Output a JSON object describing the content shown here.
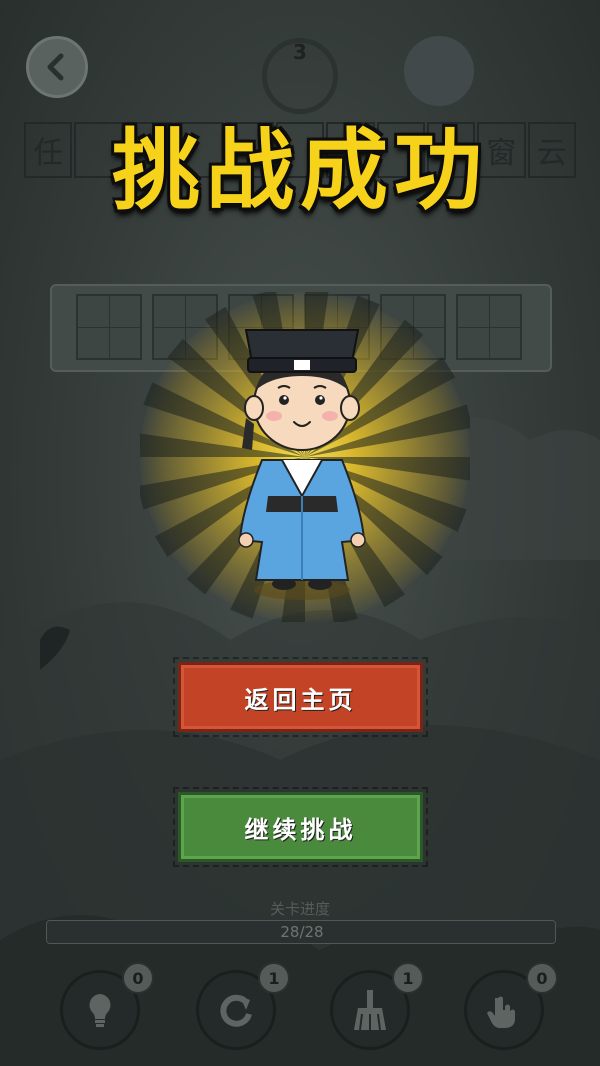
{
  "level": {
    "number": "3"
  },
  "clue_cells": [
    "任",
    "",
    "",
    "",
    "",
    "",
    "",
    "",
    "",
    "窗",
    "云"
  ],
  "title": "挑战成功",
  "buttons": {
    "home_label": "返回主页",
    "continue_label": "继续挑战"
  },
  "progress": {
    "label": "关卡进度",
    "text": "28/28",
    "current": 28,
    "total": 28
  },
  "tools": [
    {
      "name": "hint",
      "icon": "lightbulb-icon",
      "count": "0"
    },
    {
      "name": "refresh",
      "icon": "refresh-icon",
      "count": "1"
    },
    {
      "name": "clear",
      "icon": "broom-icon",
      "count": "1"
    },
    {
      "name": "pointer",
      "icon": "hand-pointer-icon",
      "count": "0"
    }
  ],
  "colors": {
    "title": "#f6d21a",
    "home_button": "#c24325",
    "continue_button": "#4a8a3c"
  }
}
